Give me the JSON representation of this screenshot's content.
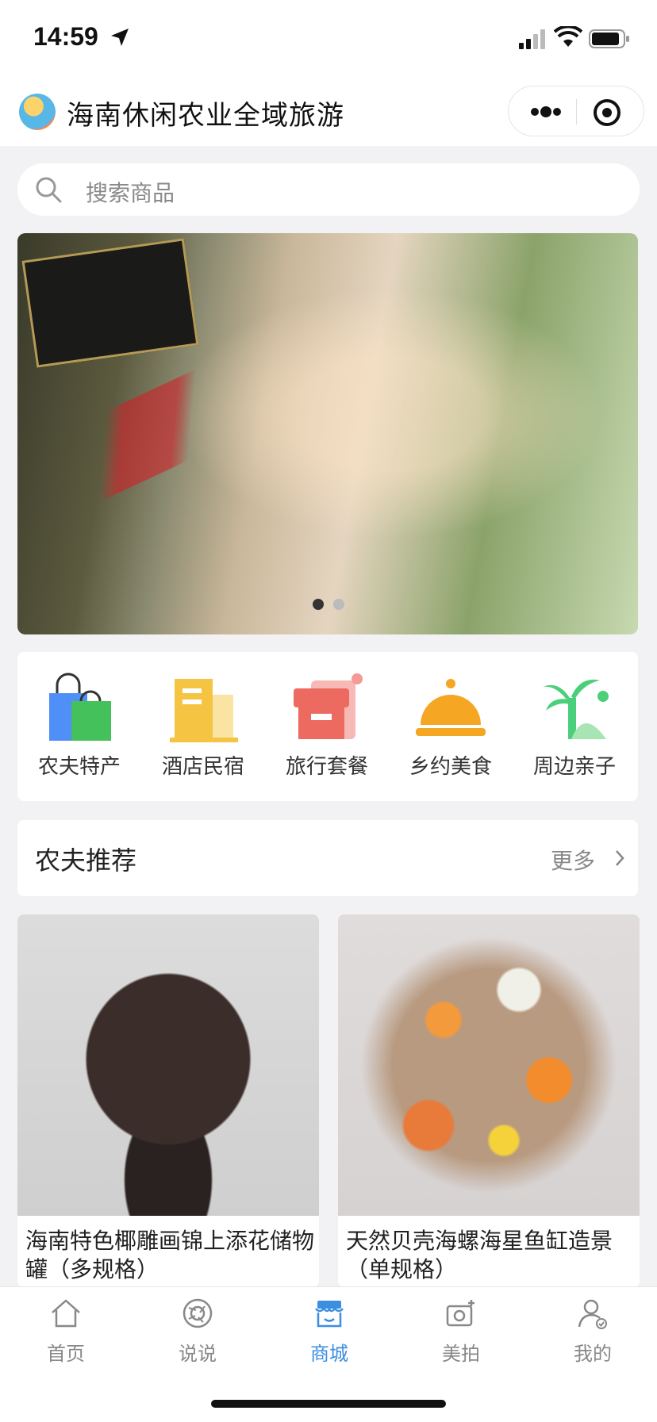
{
  "status_bar": {
    "time": "14:59",
    "icons": [
      "location-arrow-icon",
      "signal-icon",
      "wifi-icon",
      "battery-icon"
    ]
  },
  "title_bar": {
    "title": "海南休闲农业全域旅游",
    "capsule_icons": [
      "more-icon",
      "close-mini-program-icon"
    ]
  },
  "search": {
    "placeholder": "搜索商品"
  },
  "banner": {
    "slide_count": 2,
    "active_index": 0
  },
  "categories": [
    {
      "label": "农夫特产",
      "icon": "shopping-bag-icon"
    },
    {
      "label": "酒店民宿",
      "icon": "hotel-icon"
    },
    {
      "label": "旅行套餐",
      "icon": "shop-icon"
    },
    {
      "label": "乡约美食",
      "icon": "food-cloche-icon"
    },
    {
      "label": "周边亲子",
      "icon": "palm-tree-icon"
    }
  ],
  "recommend": {
    "title": "农夫推荐",
    "more": "更多"
  },
  "products": [
    {
      "name": "海南特色椰雕画锦上添花储物罐（多规格）"
    },
    {
      "name": "天然贝壳海螺海星鱼缸造景（单规格）"
    }
  ],
  "tabbar": {
    "active_index": 2,
    "items": [
      {
        "label": "首页",
        "icon": "home-icon"
      },
      {
        "label": "说说",
        "icon": "moments-icon"
      },
      {
        "label": "商城",
        "icon": "store-icon"
      },
      {
        "label": "美拍",
        "icon": "camera-icon"
      },
      {
        "label": "我的",
        "icon": "profile-icon"
      }
    ]
  },
  "colors": {
    "accent": "#3b8ee0",
    "background": "#f2f2f4"
  }
}
